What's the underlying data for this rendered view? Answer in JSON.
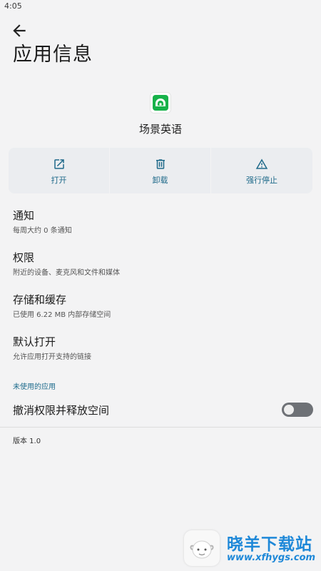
{
  "status_bar": {
    "time": "4:05"
  },
  "header": {
    "title": "应用信息"
  },
  "app": {
    "name": "场景英语"
  },
  "actions": [
    {
      "label": "打开",
      "icon": "open-external-icon"
    },
    {
      "label": "卸载",
      "icon": "trash-icon"
    },
    {
      "label": "强行停止",
      "icon": "warning-icon"
    }
  ],
  "preferences": [
    {
      "title": "通知",
      "summary": "每周大约 0 条通知"
    },
    {
      "title": "权限",
      "summary": "附近的设备、麦克风和文件和媒体"
    },
    {
      "title": "存储和缓存",
      "summary": "已使用 6.22 MB 内部存储空间"
    },
    {
      "title": "默认打开",
      "summary": "允许应用打开支持的链接"
    }
  ],
  "unused_apps": {
    "header": "未使用的应用",
    "toggle_label": "撤消权限并释放空间",
    "toggle_on": false
  },
  "version": "版本 1.0",
  "watermark": {
    "title": "晓羊下载站",
    "url": "www.xfhygs.com"
  },
  "colors": {
    "accent": "#1f6a8a",
    "app_icon_green": "#17b24a",
    "watermark_blue": "#1e88d8"
  }
}
